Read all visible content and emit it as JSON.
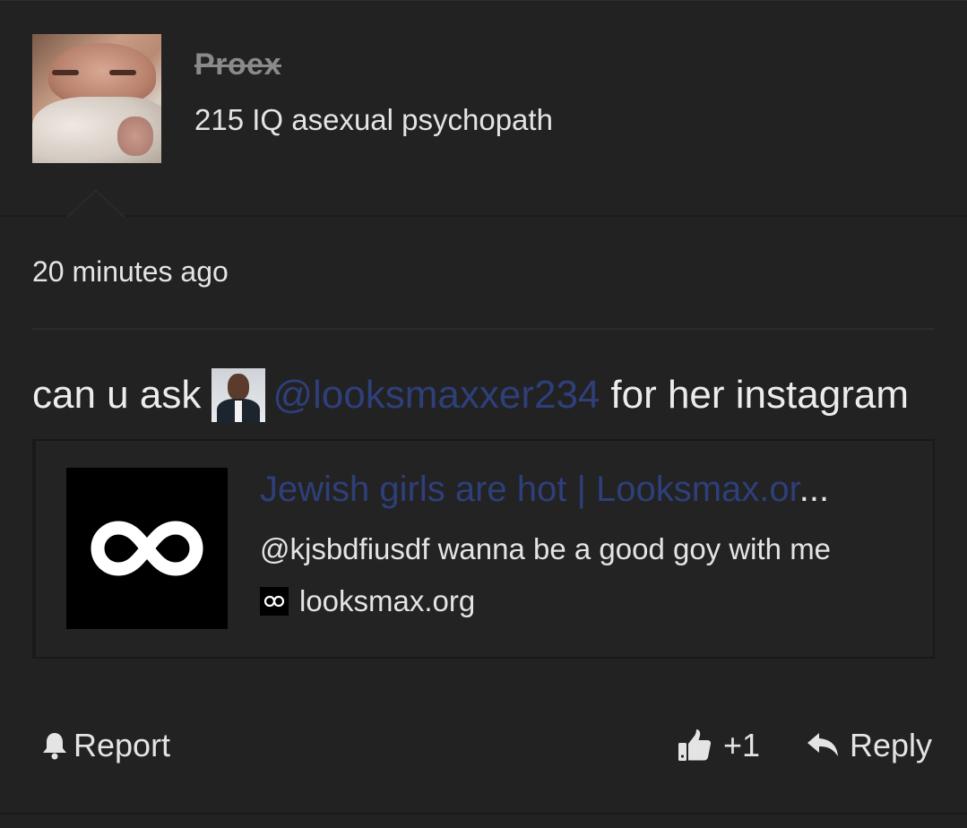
{
  "user": {
    "name": "Proex",
    "title": "215 IQ asexual psychopath"
  },
  "post": {
    "timestamp": "20 minutes ago",
    "text_before": "can u ask",
    "mention": "@looksmaxxer234",
    "text_after": "for her instagram"
  },
  "link_preview": {
    "title": "Jewish girls are hot | Looksmax.or",
    "title_ellipsis": "...",
    "description": "@kjsbdfiusdf wanna be a good goy with me",
    "domain": "looksmax.org"
  },
  "actions": {
    "report_label": "Report",
    "like_count": "+1",
    "reply_label": "Reply"
  },
  "colors": {
    "background": "#222222",
    "mention_link": "#2e3f7a",
    "text": "#e4e4e4",
    "username_struck": "#8a8a8a"
  },
  "icons": {
    "report": "bell-icon",
    "like": "thumbs-up-icon",
    "reply": "reply-arrow-icon",
    "site_logo": "infinity-logo-icon"
  }
}
